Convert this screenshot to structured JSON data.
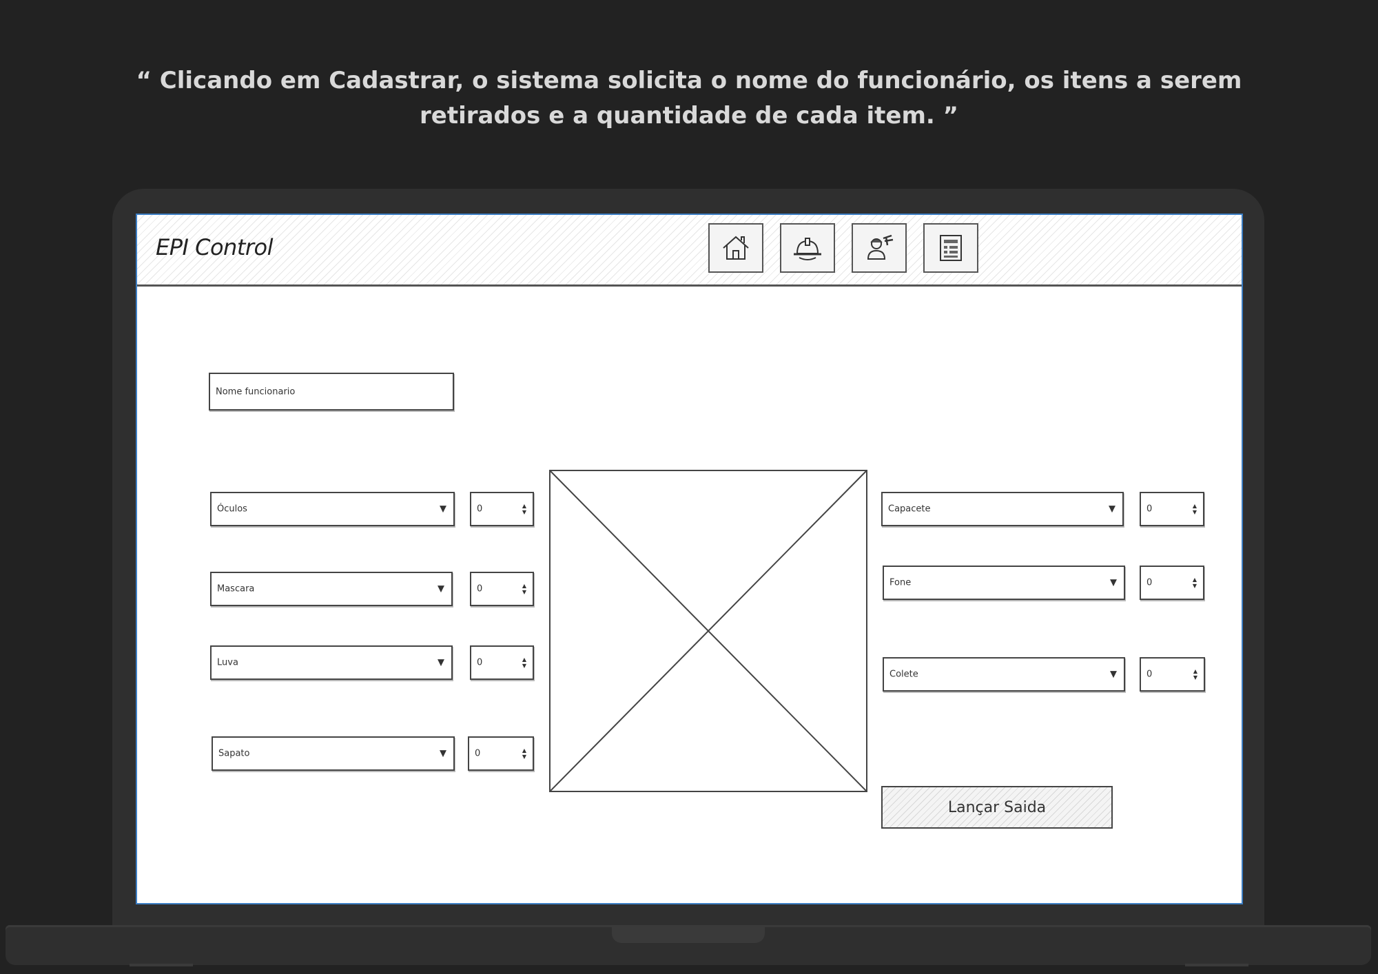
{
  "caption": "“ Clicando em Cadastrar, o sistema solicita o nome do funcionário, os itens a serem retirados e a quantidade de cada item.  ”",
  "app": {
    "title": "EPI Control",
    "nav": [
      {
        "icon": "home-icon"
      },
      {
        "icon": "helmet-icon"
      },
      {
        "icon": "worker-icon"
      },
      {
        "icon": "report-icon"
      }
    ]
  },
  "form": {
    "employee_placeholder": "Nome funcionario",
    "left_items": [
      {
        "select": "Óculos",
        "qty": "0"
      },
      {
        "select": "Mascara",
        "qty": "0"
      },
      {
        "select": "Luva",
        "qty": "0"
      },
      {
        "select": "Sapato",
        "qty": "0"
      }
    ],
    "right_items": [
      {
        "select": "Capacete",
        "qty": "0"
      },
      {
        "select": "Fone",
        "qty": "0"
      },
      {
        "select": "Colete",
        "qty": "0"
      }
    ],
    "submit_label": "Lançar Saida"
  },
  "colors": {
    "background": "#222222",
    "laptop": "#2f2f2f",
    "screen_border": "#3c7ec4",
    "caption": "#d9d9d9"
  }
}
